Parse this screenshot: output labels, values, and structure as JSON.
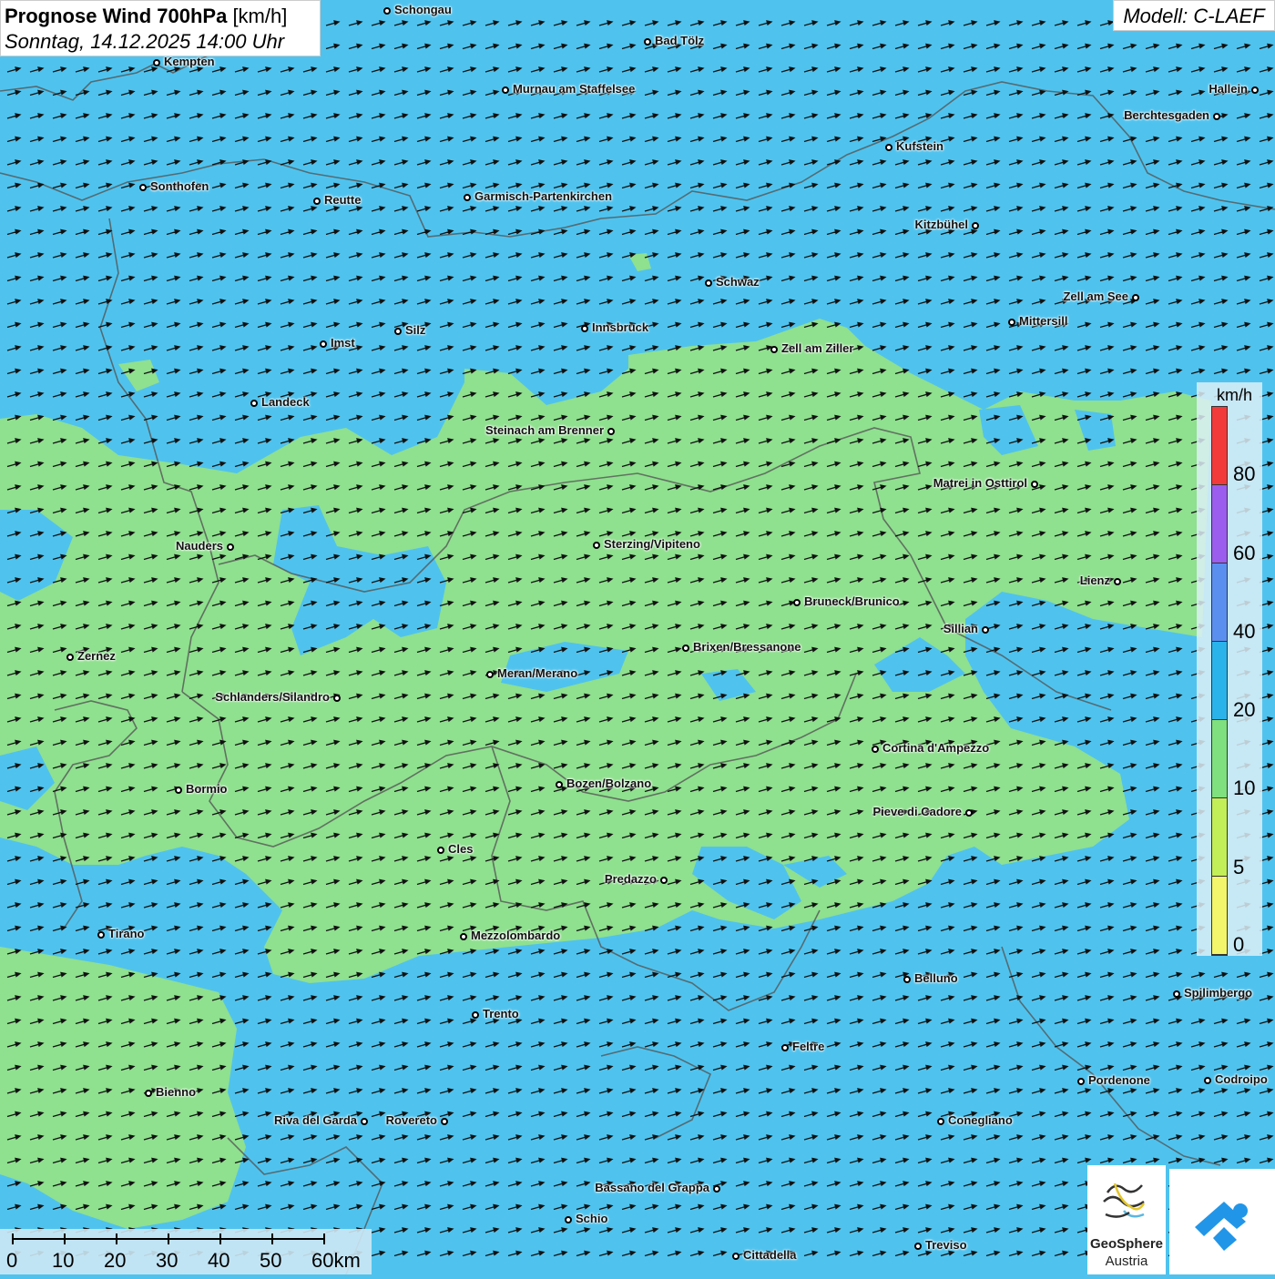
{
  "title": {
    "bold": "Prognose Wind 700hPa",
    "unit": "[km/h]",
    "date": "Sonntag, 14.12.2025 14:00 Uhr"
  },
  "model": "Modell: C-LAEF",
  "legend": {
    "unit": "km/h",
    "ticks": [
      "80",
      "60",
      "40",
      "20",
      "10",
      "5",
      "0"
    ],
    "colors": [
      "#f23a3a",
      "#9b5ded",
      "#5a8ff0",
      "#29b3ea",
      "#7ee07e",
      "#c2ee58",
      "#f3f56a"
    ]
  },
  "scalebar": {
    "labels": [
      "0",
      "10",
      "20",
      "30",
      "40",
      "50",
      "60km"
    ]
  },
  "logo": {
    "name": "GeoSphere",
    "sub": "Austria"
  },
  "map_colors": {
    "wind_10_20": "#4fc3ee",
    "wind_5_10": "#8fe08f",
    "borders": "#555555"
  },
  "cities": [
    {
      "name": "Schongau"
    },
    {
      "name": "Bad Tölz"
    },
    {
      "name": "Kempten"
    },
    {
      "name": "Murnau am Staffelsee"
    },
    {
      "name": "Hallein"
    },
    {
      "name": "Berchtesgaden"
    },
    {
      "name": "Kufstein"
    },
    {
      "name": "Sonthofen"
    },
    {
      "name": "Reutte"
    },
    {
      "name": "Garmisch-Partenkirchen"
    },
    {
      "name": "Kitzbühel"
    },
    {
      "name": "Schwaz"
    },
    {
      "name": "Zell am See"
    },
    {
      "name": "Mittersill"
    },
    {
      "name": "Innsbruck"
    },
    {
      "name": "Silz"
    },
    {
      "name": "Imst"
    },
    {
      "name": "Zell am Ziller"
    },
    {
      "name": "Landeck"
    },
    {
      "name": "Steinach am Brenner"
    },
    {
      "name": "Matrei in Osttirol"
    },
    {
      "name": "Nauders"
    },
    {
      "name": "Sterzing/Vipiteno"
    },
    {
      "name": "Lienz"
    },
    {
      "name": "Bruneck/Brunico"
    },
    {
      "name": "Sillian"
    },
    {
      "name": "Zernez"
    },
    {
      "name": "Brixen/Bressanone"
    },
    {
      "name": "Meran/Merano"
    },
    {
      "name": "Schlanders/Silandro"
    },
    {
      "name": "Cortina d'Ampezzo"
    },
    {
      "name": "Bormio"
    },
    {
      "name": "Bozen/Bolzano"
    },
    {
      "name": "Pieve di Cadore"
    },
    {
      "name": "Cles"
    },
    {
      "name": "Predazzo"
    },
    {
      "name": "Tirano"
    },
    {
      "name": "Mezzolombardo"
    },
    {
      "name": "Belluno"
    },
    {
      "name": "Spilimbergo"
    },
    {
      "name": "Trento"
    },
    {
      "name": "Feltre"
    },
    {
      "name": "Pordenone"
    },
    {
      "name": "Codroipo"
    },
    {
      "name": "Bienno"
    },
    {
      "name": "Riva del Garda"
    },
    {
      "name": "Rovereto"
    },
    {
      "name": "Conegliano"
    },
    {
      "name": "Bassano del Grappa"
    },
    {
      "name": "Schio"
    },
    {
      "name": "Treviso"
    },
    {
      "name": "Cittadella"
    }
  ]
}
